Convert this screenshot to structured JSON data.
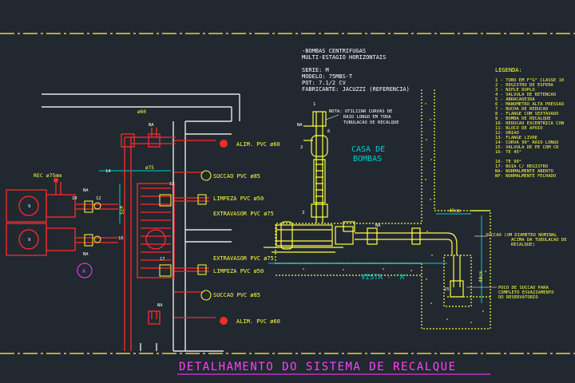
{
  "title": "DETALHAMENTO DO SISTEMA DE RECALQUE",
  "pump_spec": {
    "l1": "-BOMBAS CENTRIFUGAS",
    "l2": "MULTI-ESTAGIO HORIZONTAIS",
    "l3": "SERIE: M",
    "l4": "MODELO: 75MBS-T",
    "l5": "POT: 7.1/2 CV",
    "l6": "FABRICANTE: JACUZZI (REFERENCIA)"
  },
  "note": {
    "l1": "NOTA: UTILIZAR CURVAS DE",
    "l2": "RAIO LONGO EM TODA",
    "l3": "TUBULACAO DE RECALQUE"
  },
  "room": {
    "l1": "CASA DE",
    "l2": "BOMBAS"
  },
  "view_label": "VISTA - \"A\"",
  "legend": {
    "title": "LEGENDA:",
    "items": [
      "1 - TUBO EM F°G° CLASSE 10",
      "2 - REGISTRO DE ESFERA",
      "3 - NIPLE DUPLO",
      "4 - VALVULA DE RETENCAO",
      "5 - ABRACADEIRA",
      "6 - MANOMETRO ALTA PRESSAO",
      "7 - BUCHA DE REDUCAO",
      "8 - FLANGE COM SEXTAVADO",
      "9 - BOMBA DE RECALQUE",
      "10- REDUCAO EXCENTRICA CON",
      "11- BLOCO DE APOIO",
      "12- UNIAO",
      "13- FLANGE LIVRE",
      "14- CURVA 90° RAIO LONGO",
      "15- VALVULA DE PE COM CR",
      "16- TE 45°",
      "",
      "16- TE 90°",
      "17- BOIA C/ REGISTRO",
      "NA- NORMALMENTE ABERTO",
      "NF- NORMALMENTE FECHADO"
    ]
  },
  "pipe_labels": {
    "alim_top": "ALIM. PVC ø60",
    "succao_top": "SUCCAO PVC ø85",
    "limpeza_top": "LIMPEZA PVC ø50",
    "extravasor_top": "EXTRAVASOR PVC ø75",
    "extravasor_bot": "EXTRAVASOR PVC ø75",
    "limpeza_bot": "LIMPEZA PVC ø50",
    "succao_bot": "SUCCAO PVC ø85",
    "alim_bot": "ALIM. PVC ø60"
  },
  "rec_label": "REC ø75mm",
  "dims": {
    "d60": "ø60",
    "d75a": "ø75",
    "d75b": "ø75",
    "d40cm": "40cm",
    "d40cm_v": "40cm"
  },
  "callout_A": "A",
  "succao_note": {
    "l1": "SUCCAO (UM DIAMETRO NOMINAL",
    "l2": "ACIMA DA TUBULACAO DE",
    "l3": "RECALQUE)"
  },
  "poco_note": {
    "l1": "POCO DE SUCCAO PARA",
    "l2": "COMPLETO ESVAZIAMENTO",
    "l3": "DO RESERVATORIO"
  },
  "tags": {
    "na1": "NA",
    "na2": "NA",
    "na3": "NA",
    "na4": "NA",
    "na5": "NA",
    "na6": "NA",
    "n14": "14",
    "n13": "13",
    "n12": "12",
    "n10": "10",
    "n9a": "9",
    "n9b": "9",
    "n16": "16",
    "n17": "17",
    "n1": "1",
    "n2": "2",
    "n3": "3",
    "n6": "6",
    "n15": "15"
  },
  "colors": {
    "background": "#212830",
    "pipe": "#ff2a2a",
    "structure": "#e6e6e6",
    "detail": "#ffff3c",
    "dims": "#00d0d0",
    "text_white": "#ffffff",
    "title": "#ff40ff",
    "note": "#ffffff"
  }
}
